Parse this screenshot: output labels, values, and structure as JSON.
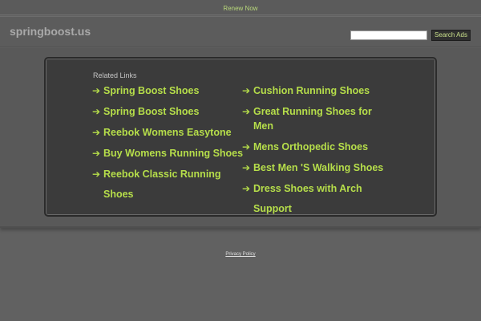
{
  "topbar": {
    "renew_label": "Renew Now"
  },
  "header": {
    "site_name": "springboost.us",
    "search_placeholder": "",
    "search_button_label": "Search Ads"
  },
  "main": {
    "related_label": "Related Links",
    "links_left": [
      "Spring Boost Shoes",
      "Spring Boost Shoes",
      "Reebok Womens Easytone",
      "Buy Womens Running Shoes",
      "Reebok Classic Running Shoes"
    ],
    "links_right": [
      "Cushion Running Shoes",
      "Great Running Shoes for Men",
      "Mens Orthopedic Shoes",
      "Best Men 'S Walking Shoes",
      "Dress Shoes with Arch Support"
    ]
  },
  "footer": {
    "privacy_label": "Privacy Policy"
  },
  "colors": {
    "link_green": "#b6de4a",
    "background": "#616161",
    "panel": "#3b3b3b"
  }
}
